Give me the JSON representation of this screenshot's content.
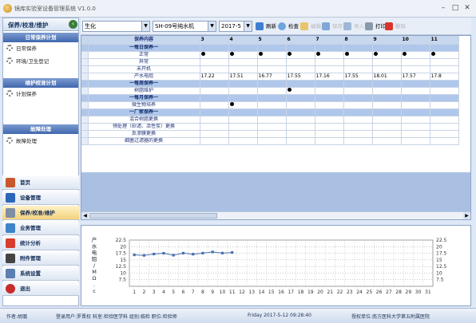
{
  "app": {
    "title": "镜库实验室设备管理系统 V1.0.0"
  },
  "left": {
    "header": "保养/校准/维护",
    "groups": [
      {
        "title": "日常保养计划",
        "items": [
          "日常保养",
          "环境/卫生登记"
        ]
      },
      {
        "title": "维护校准计划",
        "items": [
          "计划保养"
        ]
      },
      {
        "title": "故障处理",
        "items": [
          "故障处理"
        ]
      }
    ],
    "nav": [
      {
        "label": "首页"
      },
      {
        "label": "设备管理"
      },
      {
        "label": "保养/校准/维护"
      },
      {
        "label": "业务管理"
      },
      {
        "label": "统计分析"
      },
      {
        "label": "附件管理"
      },
      {
        "label": "系统设置"
      },
      {
        "label": "退出"
      }
    ]
  },
  "toolbar": {
    "category": "生化",
    "device": "SH-09号纯水机",
    "month": "2017-5",
    "refresh": "刷新",
    "check": "检查",
    "edit": "编辑",
    "save": "保存",
    "delete_sm": "导入",
    "print": "打印",
    "remove": "删除"
  },
  "grid": {
    "header_label": "保养内容",
    "days": [
      "3",
      "4",
      "5",
      "6",
      "7",
      "8",
      "9",
      "10",
      "11"
    ],
    "rows": [
      {
        "label": "一每日保养一",
        "type": "section",
        "cells": [
          "",
          "",
          "",
          "",
          "",
          "",
          "",
          "",
          ""
        ]
      },
      {
        "label": "正常",
        "type": "dots",
        "cells": [
          "●",
          "●",
          "●",
          "●",
          "●",
          "●",
          "●",
          "●",
          "●"
        ]
      },
      {
        "label": "异常",
        "type": "text",
        "cells": [
          "",
          "",
          "",
          "",
          "",
          "",
          "",
          "",
          ""
        ]
      },
      {
        "label": "未开机",
        "type": "text",
        "cells": [
          "",
          "",
          "",
          "",
          "",
          "",
          "",
          "",
          ""
        ]
      },
      {
        "label": "产水电阻",
        "type": "text",
        "cells": [
          "17.22",
          "17.51",
          "16.77",
          "17.55",
          "17.16",
          "17.55",
          "18.01",
          "17.57",
          "17.8"
        ]
      },
      {
        "label": "一每周保养一",
        "type": "section",
        "cells": [
          "",
          "",
          "",
          "",
          "",
          "",
          "",
          "",
          ""
        ]
      },
      {
        "label": "树脂维护",
        "type": "dots",
        "cells": [
          "",
          "",
          "",
          "●",
          "",
          "",
          "",
          "",
          ""
        ]
      },
      {
        "label": "一每月保养一",
        "type": "section",
        "cells": [
          "",
          "",
          "",
          "",
          "",
          "",
          "",
          "",
          ""
        ]
      },
      {
        "label": "微生物培养",
        "type": "dots",
        "cells": [
          "",
          "●",
          "",
          "",
          "",
          "",
          "",
          "",
          ""
        ]
      },
      {
        "label": "一厂家保养一",
        "type": "section",
        "cells": [
          "",
          "",
          "",
          "",
          "",
          "",
          "",
          "",
          ""
        ]
      },
      {
        "label": "混合树脂更换",
        "type": "text",
        "cells": [
          "",
          "",
          "",
          "",
          "",
          "",
          "",
          "",
          ""
        ]
      },
      {
        "label": "预处理（砂滤、活性炭）更换",
        "type": "text",
        "cells": [
          "",
          "",
          "",
          "",
          "",
          "",
          "",
          "",
          ""
        ]
      },
      {
        "label": "反渗膜更换",
        "type": "text",
        "cells": [
          "",
          "",
          "",
          "",
          "",
          "",
          "",
          "",
          ""
        ]
      },
      {
        "label": "细菌过滤器的更换",
        "type": "text",
        "cells": [
          "",
          "",
          "",
          "",
          "",
          "",
          "",
          "",
          ""
        ]
      }
    ],
    "scroll_left": "◀",
    "scroll_right": "▶"
  },
  "chart_data": {
    "type": "line",
    "ylabel": "产水电阻(MΩ.cm)",
    "ylabel_chars": [
      "产",
      "水",
      "电",
      "阻",
      "/",
      "M",
      "Ω",
      ".",
      "c"
    ],
    "ylim": [
      5,
      22.5
    ],
    "yticks": [
      "22.5",
      "20",
      "17.5",
      "15",
      "12.5",
      "10",
      "7.5"
    ],
    "x": [
      "1",
      "2",
      "3",
      "4",
      "5",
      "6",
      "7",
      "8",
      "9",
      "10",
      "11",
      "12",
      "13",
      "14",
      "15",
      "16",
      "17",
      "18",
      "19",
      "20",
      "21",
      "22",
      "23",
      "24",
      "25",
      "26",
      "27",
      "28",
      "29",
      "30",
      "31"
    ],
    "series": [
      {
        "values": [
          16.9,
          16.7,
          17.22,
          17.51,
          16.77,
          17.55,
          17.16,
          17.55,
          18.01,
          17.57,
          17.8
        ]
      }
    ],
    "grid": true,
    "line_color": "#4a6fae"
  },
  "status": {
    "version": "作者:胡璐",
    "user": "登录用户:罗晋权  科室:检验医学科  组别:临检  职位:检验师",
    "time": "Friday 2017-5-12 09:28:40",
    "org": "授权单位:南方医科大学第五附属医院"
  }
}
